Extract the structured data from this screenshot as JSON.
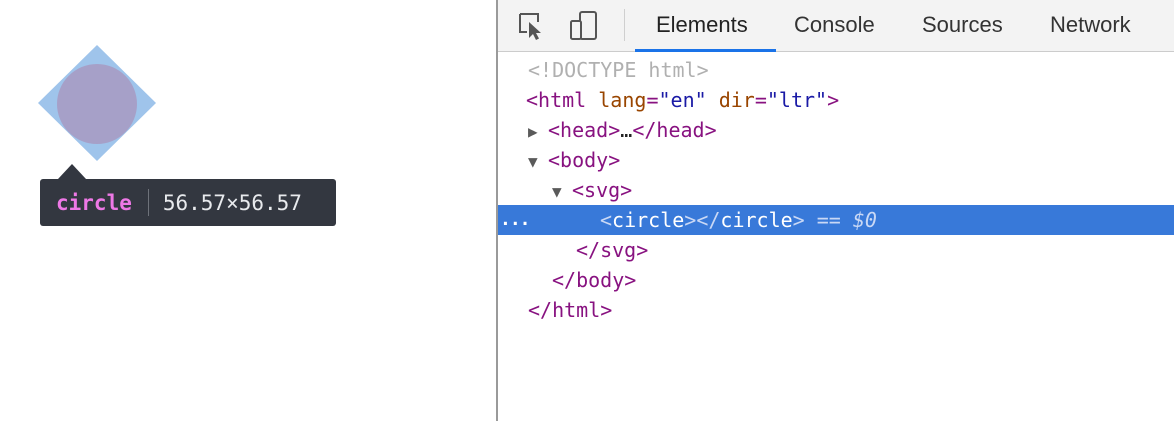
{
  "viewport": {
    "tooltip": {
      "tag": "circle",
      "dimensions": "56.57×56.57"
    },
    "colors": {
      "highlight_fill": "#9fc4eb",
      "circle_fill": "#a6a0c8",
      "tooltip_bg": "#333740",
      "tooltip_tag": "#ee78e6"
    }
  },
  "devtools": {
    "toolbar": {
      "icons": [
        "inspect-element-icon",
        "device-toolbar-icon"
      ],
      "tabs": [
        {
          "label": "Elements",
          "active": true
        },
        {
          "label": "Console",
          "active": false
        },
        {
          "label": "Sources",
          "active": false
        },
        {
          "label": "Network",
          "active": false
        }
      ]
    },
    "dom_tree": {
      "doctype": "<!DOCTYPE html>",
      "html_open": {
        "tag": "html",
        "attrs": [
          {
            "name": "lang",
            "value": "\"en\""
          },
          {
            "name": "dir",
            "value": "\"ltr\""
          }
        ]
      },
      "head": {
        "tag": "head",
        "ellipsis": "…"
      },
      "body": {
        "tag": "body"
      },
      "svg": {
        "tag": "svg"
      },
      "circle": {
        "tag": "circle",
        "ref": "== $0"
      },
      "svg_close": "</svg>",
      "body_close": "</body>",
      "html_close": "</html>",
      "gutter": "..."
    },
    "colors": {
      "selection": "#3879d9",
      "accent": "#1a73e8"
    }
  }
}
